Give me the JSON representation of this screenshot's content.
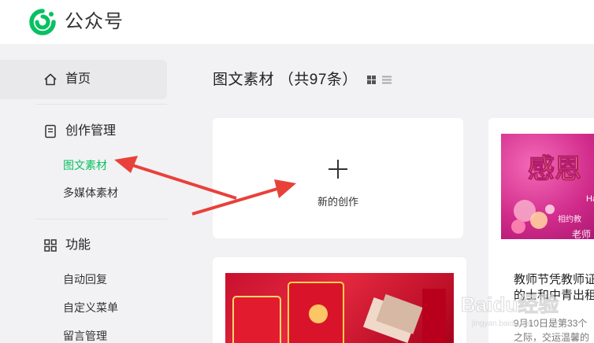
{
  "header": {
    "brand": "公众号"
  },
  "sidebar": {
    "home": {
      "label": "首页",
      "icon": "home-icon"
    },
    "create": {
      "label": "创作管理",
      "icon": "document-icon",
      "items": [
        {
          "label": "图文素材",
          "active": true
        },
        {
          "label": "多媒体素材",
          "active": false
        }
      ]
    },
    "features": {
      "label": "功能",
      "icon": "grid-icon",
      "items": [
        {
          "label": "自动回复"
        },
        {
          "label": "自定义菜单"
        },
        {
          "label": "留言管理"
        }
      ]
    }
  },
  "main": {
    "title": "图文素材 （共97条）",
    "new_card": {
      "label": "新的创作"
    },
    "articles": [
      {
        "title": "教师节凭教师证",
        "title_line2": "的士和中青出租",
        "desc": "9月10日是第33个",
        "desc_line2": "之际，交运温馨的",
        "thumb_text": "感恩",
        "thumb_sub": "相约教",
        "thumb_sign": "老师",
        "thumb_edge": "Hap"
      },
      {
        "title": "",
        "desc": ""
      }
    ]
  },
  "watermark": {
    "text": "Baidu经验",
    "url": "jingyan.baidu.com"
  },
  "colors": {
    "accent": "#07c160",
    "arrow": "#e8413a",
    "background": "#f2f2f4"
  }
}
